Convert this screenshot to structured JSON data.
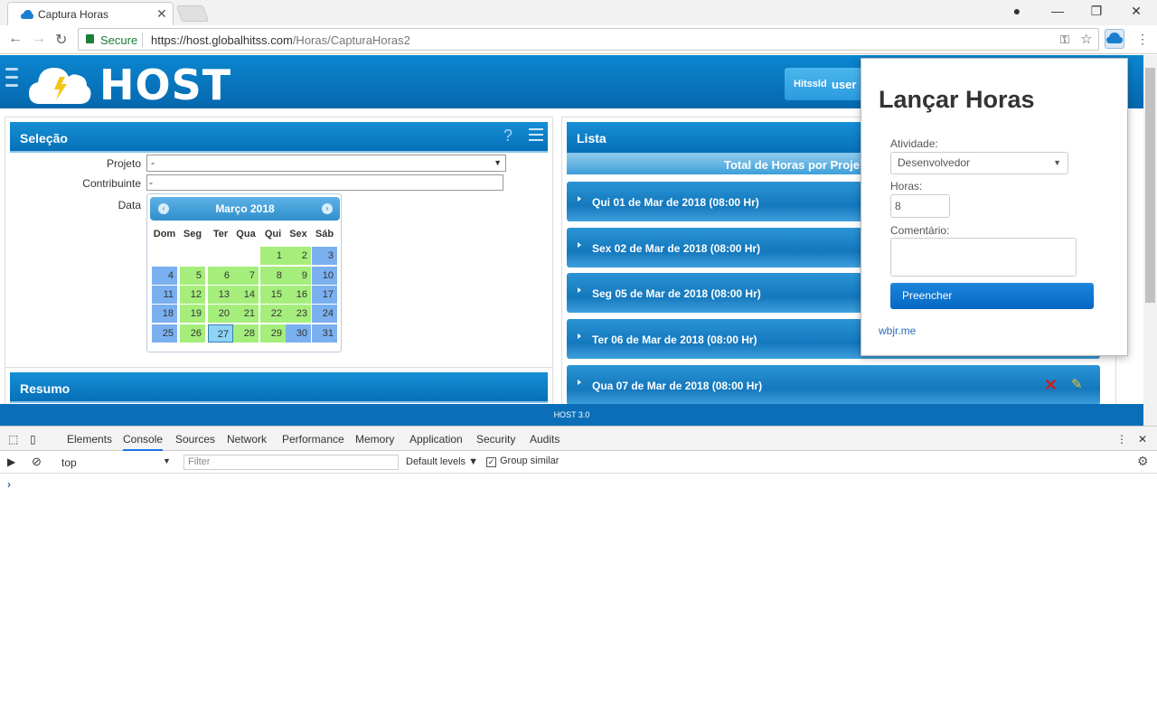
{
  "browser": {
    "tab_title": "Captura Horas",
    "secure_label": "Secure",
    "url_host": "https://host.globalhitss.com",
    "url_path": "/Horas/CapturaHoras2"
  },
  "header": {
    "logo_text": "HOST",
    "user_label": "Hitssld",
    "user_name": "user"
  },
  "selecao": {
    "title": "Seleção",
    "help_glyph": "?",
    "projeto_label": "Projeto",
    "projeto_value": "-",
    "contribuinte_label": "Contribuinte",
    "contribuinte_value": "-",
    "data_label": "Data"
  },
  "calendar": {
    "month_title": "Março 2018",
    "prev_glyph": "‹",
    "next_glyph": "›",
    "weekdays": [
      "Dom",
      "Seg",
      "Ter",
      "Qua",
      "Qui",
      "Sex",
      "Sáb"
    ],
    "days": [
      [
        "",
        "",
        "",
        "",
        "1",
        "2",
        "3"
      ],
      [
        "4",
        "5",
        "6",
        "7",
        "8",
        "9",
        "10"
      ],
      [
        "11",
        "12",
        "13",
        "14",
        "15",
        "16",
        "17"
      ],
      [
        "18",
        "19",
        "20",
        "21",
        "22",
        "23",
        "24"
      ],
      [
        "25",
        "26",
        "27",
        "28",
        "29",
        "30",
        "31"
      ]
    ],
    "green_color": "#a6ee7c",
    "blue_color": "#7ab0ef",
    "today_color": "#8fd3f5"
  },
  "resumo": {
    "title": "Resumo"
  },
  "lista": {
    "title": "Lista",
    "total_label": "Total de Horas por Proje",
    "rows": [
      "Qui 01 de Mar de 2018 (08:00 Hr)",
      "Sex 02 de Mar de 2018 (08:00 Hr)",
      "Seg 05 de Mar de 2018 (08:00 Hr)",
      "Ter 06 de Mar de 2018 (08:00 Hr)",
      "Qua 07 de Mar de 2018 (08:00 Hr)"
    ]
  },
  "footer": {
    "text": "HOST 3.0"
  },
  "popup": {
    "title": "Lançar Horas",
    "atividade_label": "Atividade:",
    "atividade_value": "Desenvolvedor",
    "horas_label": "Horas:",
    "horas_value": "8",
    "comentario_label": "Comentário:",
    "button_label": "Preencher",
    "link_text": "wbjr.me"
  },
  "devtools": {
    "tabs": [
      "Elements",
      "Console",
      "Sources",
      "Network",
      "Performance",
      "Memory",
      "Application",
      "Security",
      "Audits"
    ],
    "active_tab": "Console",
    "context": "top",
    "filter_placeholder": "Filter",
    "levels": "Default levels",
    "group_similar": "Group similar",
    "prompt": "›"
  }
}
